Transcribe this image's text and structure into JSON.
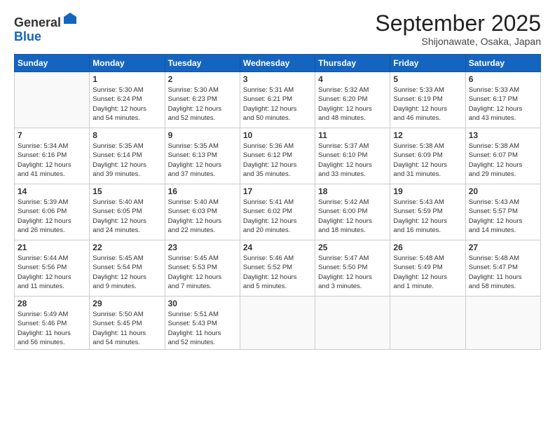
{
  "logo": {
    "general": "General",
    "blue": "Blue"
  },
  "title": "September 2025",
  "location": "Shijonawate, Osaka, Japan",
  "days_header": [
    "Sunday",
    "Monday",
    "Tuesday",
    "Wednesday",
    "Thursday",
    "Friday",
    "Saturday"
  ],
  "weeks": [
    [
      {
        "day": "",
        "info": ""
      },
      {
        "day": "1",
        "info": "Sunrise: 5:30 AM\nSunset: 6:24 PM\nDaylight: 12 hours\nand 54 minutes."
      },
      {
        "day": "2",
        "info": "Sunrise: 5:30 AM\nSunset: 6:23 PM\nDaylight: 12 hours\nand 52 minutes."
      },
      {
        "day": "3",
        "info": "Sunrise: 5:31 AM\nSunset: 6:21 PM\nDaylight: 12 hours\nand 50 minutes."
      },
      {
        "day": "4",
        "info": "Sunrise: 5:32 AM\nSunset: 6:20 PM\nDaylight: 12 hours\nand 48 minutes."
      },
      {
        "day": "5",
        "info": "Sunrise: 5:33 AM\nSunset: 6:19 PM\nDaylight: 12 hours\nand 46 minutes."
      },
      {
        "day": "6",
        "info": "Sunrise: 5:33 AM\nSunset: 6:17 PM\nDaylight: 12 hours\nand 43 minutes."
      }
    ],
    [
      {
        "day": "7",
        "info": "Sunrise: 5:34 AM\nSunset: 6:16 PM\nDaylight: 12 hours\nand 41 minutes."
      },
      {
        "day": "8",
        "info": "Sunrise: 5:35 AM\nSunset: 6:14 PM\nDaylight: 12 hours\nand 39 minutes."
      },
      {
        "day": "9",
        "info": "Sunrise: 5:35 AM\nSunset: 6:13 PM\nDaylight: 12 hours\nand 37 minutes."
      },
      {
        "day": "10",
        "info": "Sunrise: 5:36 AM\nSunset: 6:12 PM\nDaylight: 12 hours\nand 35 minutes."
      },
      {
        "day": "11",
        "info": "Sunrise: 5:37 AM\nSunset: 6:10 PM\nDaylight: 12 hours\nand 33 minutes."
      },
      {
        "day": "12",
        "info": "Sunrise: 5:38 AM\nSunset: 6:09 PM\nDaylight: 12 hours\nand 31 minutes."
      },
      {
        "day": "13",
        "info": "Sunrise: 5:38 AM\nSunset: 6:07 PM\nDaylight: 12 hours\nand 29 minutes."
      }
    ],
    [
      {
        "day": "14",
        "info": "Sunrise: 5:39 AM\nSunset: 6:06 PM\nDaylight: 12 hours\nand 26 minutes."
      },
      {
        "day": "15",
        "info": "Sunrise: 5:40 AM\nSunset: 6:05 PM\nDaylight: 12 hours\nand 24 minutes."
      },
      {
        "day": "16",
        "info": "Sunrise: 5:40 AM\nSunset: 6:03 PM\nDaylight: 12 hours\nand 22 minutes."
      },
      {
        "day": "17",
        "info": "Sunrise: 5:41 AM\nSunset: 6:02 PM\nDaylight: 12 hours\nand 20 minutes."
      },
      {
        "day": "18",
        "info": "Sunrise: 5:42 AM\nSunset: 6:00 PM\nDaylight: 12 hours\nand 18 minutes."
      },
      {
        "day": "19",
        "info": "Sunrise: 5:43 AM\nSunset: 5:59 PM\nDaylight: 12 hours\nand 16 minutes."
      },
      {
        "day": "20",
        "info": "Sunrise: 5:43 AM\nSunset: 5:57 PM\nDaylight: 12 hours\nand 14 minutes."
      }
    ],
    [
      {
        "day": "21",
        "info": "Sunrise: 5:44 AM\nSunset: 5:56 PM\nDaylight: 12 hours\nand 11 minutes."
      },
      {
        "day": "22",
        "info": "Sunrise: 5:45 AM\nSunset: 5:54 PM\nDaylight: 12 hours\nand 9 minutes."
      },
      {
        "day": "23",
        "info": "Sunrise: 5:45 AM\nSunset: 5:53 PM\nDaylight: 12 hours\nand 7 minutes."
      },
      {
        "day": "24",
        "info": "Sunrise: 5:46 AM\nSunset: 5:52 PM\nDaylight: 12 hours\nand 5 minutes."
      },
      {
        "day": "25",
        "info": "Sunrise: 5:47 AM\nSunset: 5:50 PM\nDaylight: 12 hours\nand 3 minutes."
      },
      {
        "day": "26",
        "info": "Sunrise: 5:48 AM\nSunset: 5:49 PM\nDaylight: 12 hours\nand 1 minute."
      },
      {
        "day": "27",
        "info": "Sunrise: 5:48 AM\nSunset: 5:47 PM\nDaylight: 11 hours\nand 58 minutes."
      }
    ],
    [
      {
        "day": "28",
        "info": "Sunrise: 5:49 AM\nSunset: 5:46 PM\nDaylight: 11 hours\nand 56 minutes."
      },
      {
        "day": "29",
        "info": "Sunrise: 5:50 AM\nSunset: 5:45 PM\nDaylight: 11 hours\nand 54 minutes."
      },
      {
        "day": "30",
        "info": "Sunrise: 5:51 AM\nSunset: 5:43 PM\nDaylight: 11 hours\nand 52 minutes."
      },
      {
        "day": "",
        "info": ""
      },
      {
        "day": "",
        "info": ""
      },
      {
        "day": "",
        "info": ""
      },
      {
        "day": "",
        "info": ""
      }
    ]
  ]
}
